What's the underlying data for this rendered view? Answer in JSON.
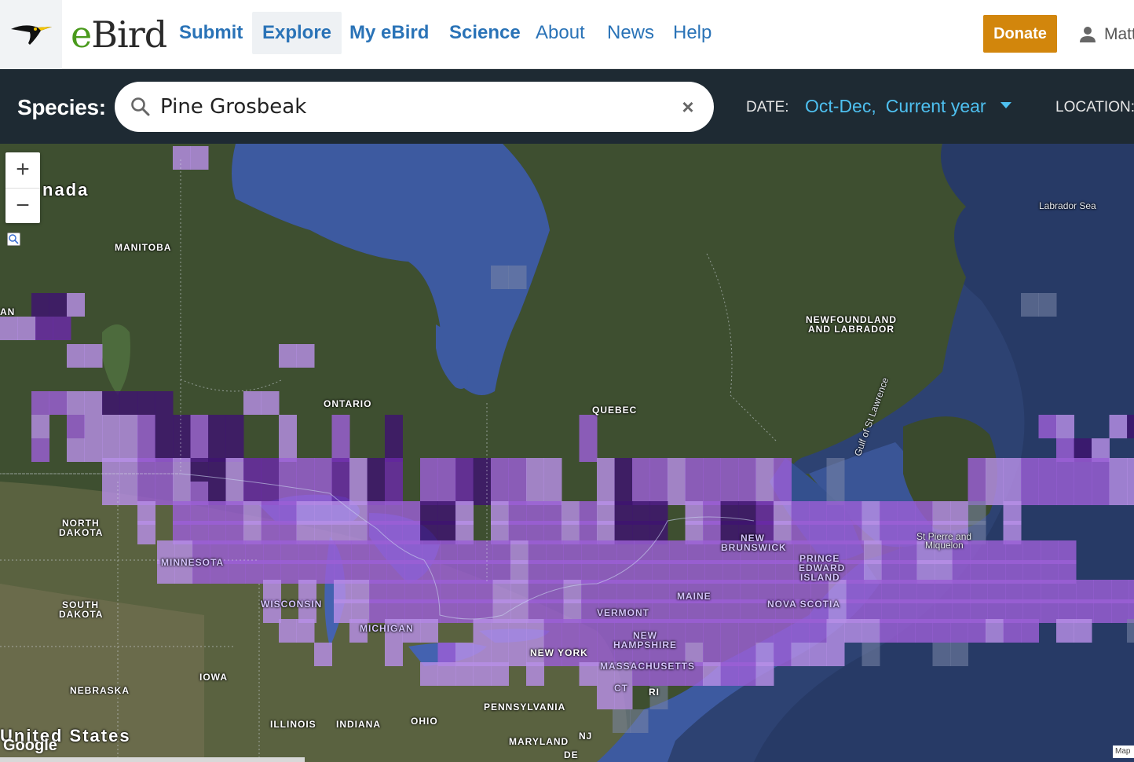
{
  "nav": {
    "brand_e": "e",
    "brand_rest": "Bird",
    "links": [
      {
        "label": "Submit"
      },
      {
        "label": "Explore"
      },
      {
        "label": "My eBird"
      },
      {
        "label": "Science"
      },
      {
        "label": "About"
      },
      {
        "label": "News"
      },
      {
        "label": "Help"
      }
    ],
    "donate_label": "Donate",
    "user_name": "Matt"
  },
  "search": {
    "species_label": "Species:",
    "value": "Pine Grosbeak",
    "clear_glyph": "×",
    "date_label": "DATE:",
    "date_months": "Oct-Dec,",
    "date_year": "Current year",
    "location_label": "LOCATION:"
  },
  "map": {
    "zoom_in": "+",
    "zoom_out": "−",
    "attribution": "Google",
    "map_data": "Map",
    "labels": {
      "canada": "nada",
      "united_states": "United States",
      "manitoba": "MANITOBA",
      "ontario": "ONTARIO",
      "quebec": "QUEBEC",
      "newfoundland_1": "NEWFOUNDLAND",
      "newfoundland_2": "AND LABRADOR",
      "labrador_sea": "Labrador Sea",
      "north_dakota_1": "NORTH",
      "north_dakota_2": "DAKOTA",
      "south_dakota_1": "SOUTH",
      "south_dakota_2": "DAKOTA",
      "minnesota": "MINNESOTA",
      "wisconsin": "WISCONSIN",
      "michigan": "MICHIGAN",
      "iowa": "IOWA",
      "nebraska": "NEBRASKA",
      "illinois": "ILLINOIS",
      "indiana": "INDIANA",
      "ohio": "OHIO",
      "pennsylvania": "PENNSYLVANIA",
      "maryland": "MARYLAND",
      "nj": "NJ",
      "de": "DE",
      "new_york": "NEW YORK",
      "vermont": "VERMONT",
      "new_hampshire_1": "NEW",
      "new_hampshire_2": "HAMPSHIRE",
      "massachusetts": "MASSACHUSETTS",
      "ct": "CT",
      "ri": "RI",
      "maine": "MAINE",
      "new_brunswick_1": "NEW",
      "new_brunswick_2": "BRUNSWICK",
      "pei_1": "PRINCE",
      "pei_2": "EDWARD",
      "pei_3": "ISLAND",
      "nova_scotia": "NOVA SCOTIA",
      "st_pierre_1": "St Pierre and",
      "st_pierre_2": "Miquelon",
      "gulf": "Gulf of St Lawrence",
      "an": "AN"
    },
    "colors": {
      "light": "#b78fe6",
      "mid": "#9b5fd6",
      "dark": "#6a2aa8",
      "darkest": "#3e1470",
      "empty": "#7b86a8"
    }
  }
}
